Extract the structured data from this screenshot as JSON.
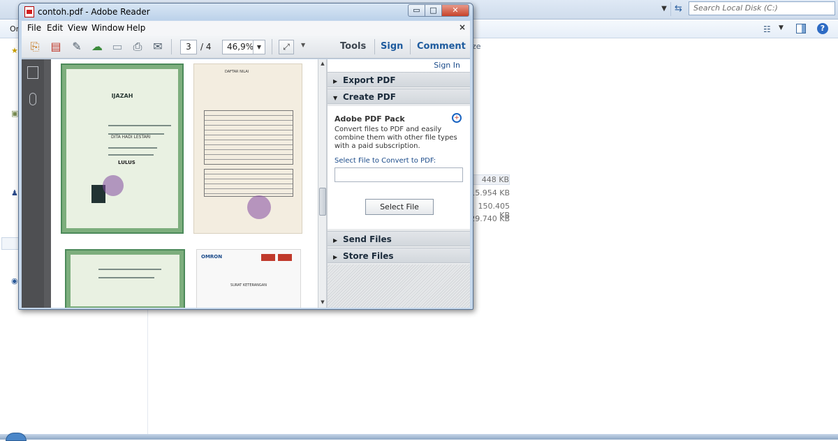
{
  "explorer": {
    "search_placeholder": "Search Local Disk (C:)",
    "cmd_left": "Or",
    "size_header": "ze",
    "sizes": [
      "448 KB",
      "15.954 KB",
      "150.405 KB",
      "29.740 KB"
    ]
  },
  "reader": {
    "title": "contoh.pdf - Adobe Reader",
    "window_buttons": {
      "minimize": "▭",
      "maximize": "□",
      "close": "✕"
    },
    "menu": [
      "File",
      "Edit",
      "View",
      "Window",
      "Help"
    ],
    "menu_close": "×",
    "toolbar": {
      "page_current": "3",
      "page_total": "/ 4",
      "zoom": "46,9%",
      "tools_label": "Tools",
      "sign_label": "Sign",
      "comment_label": "Comment",
      "icons": [
        "create-icon",
        "pdf-export-icon",
        "edit-icon",
        "cloud-upload-icon",
        "save-icon",
        "print-icon",
        "email-icon"
      ]
    },
    "document": {
      "cert_title": "IJAZAH",
      "cert_name": "DITA HADI LESTARI",
      "cert_result": "LULUS",
      "grade_title": "DAFTAR NILAI",
      "letter_brand": "OMRON",
      "letter_title": "SURAT KETERANGAN"
    },
    "panel": {
      "sign_in": "Sign In",
      "export_pdf": "Export PDF",
      "create_pdf": "Create PDF",
      "pack_title": "Adobe PDF Pack",
      "pack_desc": "Convert files to PDF and easily combine them with other file types with a paid subscription.",
      "file_label": "Select File to Convert to PDF:",
      "select_file": "Select File",
      "send_files": "Send Files",
      "store_files": "Store Files"
    }
  }
}
